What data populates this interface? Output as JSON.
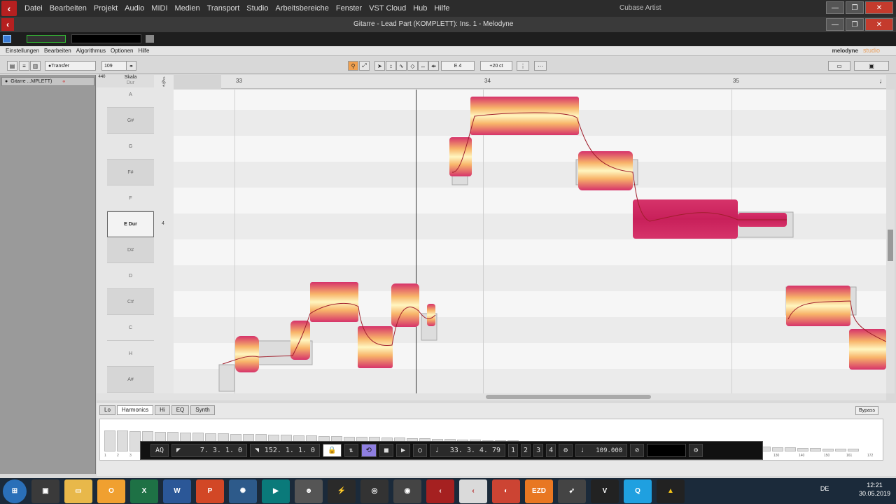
{
  "host": {
    "menu": [
      "Datei",
      "Bearbeiten",
      "Projekt",
      "Audio",
      "MIDI",
      "Medien",
      "Transport",
      "Studio",
      "Arbeitsbereiche",
      "Fenster",
      "VST Cloud",
      "Hub",
      "Hilfe"
    ],
    "app_title": "Cubase Artist",
    "plugin_window_title": "Gitarre - Lead Part (KOMPLETT): Ins. 1 - Melodyne"
  },
  "melodyne": {
    "menu": [
      "Einstellungen",
      "Bearbeiten",
      "Algorithmus",
      "Optionen",
      "Hilfe"
    ],
    "brand": "melodyne",
    "brand_edition": "studio",
    "toolbar": {
      "transfer_label": "Transfer",
      "tempo_value": "109",
      "pitch_value": "E 4",
      "cents_value": "+20 ct"
    },
    "track_name": "Gitarre ...MPLETT)",
    "scale_header": "Skala",
    "scale_sub": "Dur",
    "ref_pitch": "440",
    "scale_root_label": "E Dur",
    "scale_degree": "4",
    "pitch_rows": [
      "A",
      "G#",
      "G",
      "F#",
      "F",
      "E Dur",
      "D#",
      "D",
      "C#",
      "C",
      "H",
      "A#"
    ],
    "bar_numbers": [
      "33",
      "34",
      "35"
    ],
    "bottom_tabs": [
      "Lo",
      "Harmonics",
      "Hi",
      "EQ",
      "Synth"
    ],
    "bypass_label": "Bypass",
    "spectrum_ticks": [
      "1",
      "2",
      "3",
      "130",
      "140",
      "150",
      "161",
      "172"
    ]
  },
  "transport": {
    "aq": "AQ",
    "left_locator": "7. 3. 1.  0",
    "right_locator": "152. 1. 1.  0",
    "position": "33. 3. 4. 79",
    "tempo": "109.000",
    "markers": [
      "1",
      "2",
      "3",
      "4"
    ]
  },
  "taskbar": {
    "lang": "DE",
    "time": "12:21",
    "date": "30.05.2019"
  },
  "colors": {
    "blob_outer": "#d6336a",
    "blob_inner": "#fff6c0",
    "pitch_line": "#a01e2c"
  }
}
